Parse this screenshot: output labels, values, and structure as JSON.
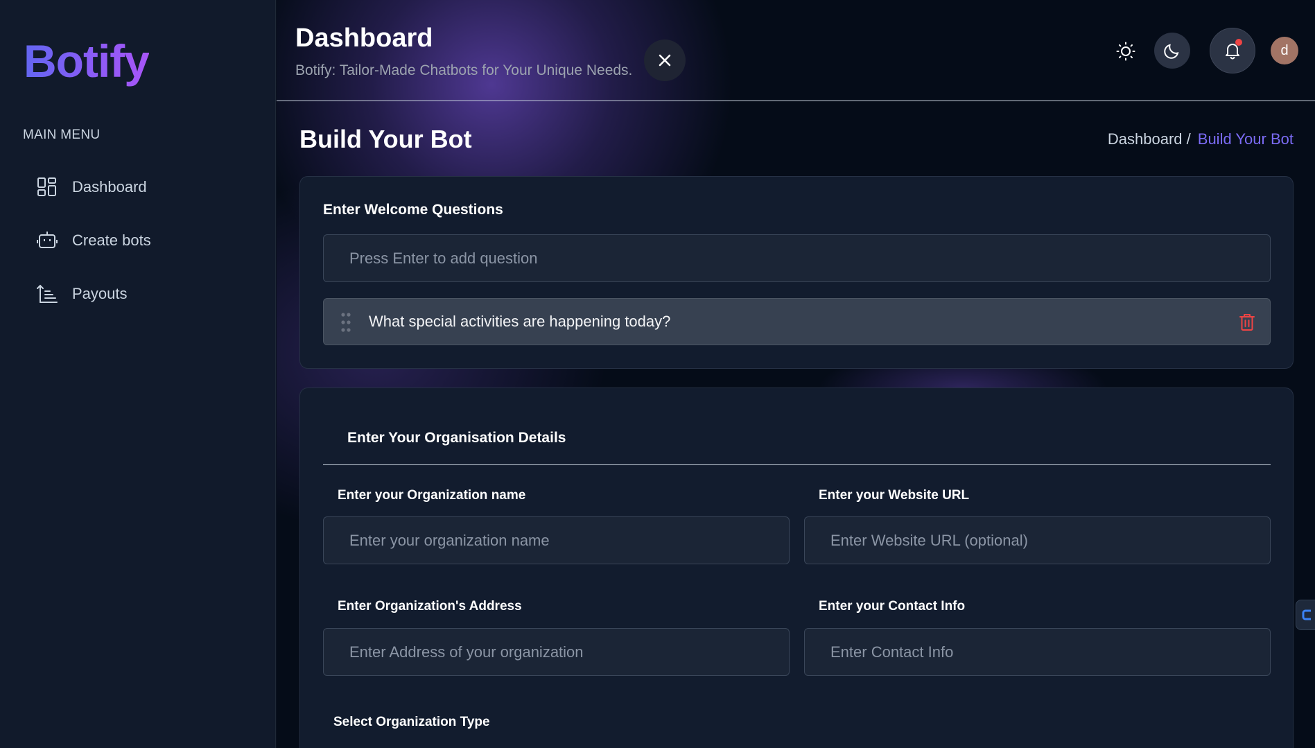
{
  "sidebar": {
    "logo": "Botify",
    "menu_heading": "MAIN MENU",
    "items": [
      {
        "label": "Dashboard",
        "icon": "dashboard-grid-icon"
      },
      {
        "label": "Create bots",
        "icon": "robot-icon"
      },
      {
        "label": "Payouts",
        "icon": "sort-list-icon"
      }
    ]
  },
  "header": {
    "title": "Dashboard",
    "subtitle": "Botify: Tailor-Made Chatbots for Your Unique Needs.",
    "avatar_initial": "d"
  },
  "page": {
    "title": "Build Your Bot",
    "breadcrumb": {
      "home": "Dashboard /",
      "current": "Build Your Bot"
    }
  },
  "welcome": {
    "heading": "Enter Welcome Questions",
    "input_placeholder": "Press Enter to add question",
    "questions": [
      "What special activities are happening today?"
    ]
  },
  "organisation": {
    "heading": "Enter Your Organisation Details",
    "fields": {
      "name": {
        "label": "Enter your Organization name",
        "placeholder": "Enter your organization name"
      },
      "website": {
        "label": "Enter your Website URL",
        "placeholder": "Enter Website URL (optional)"
      },
      "address": {
        "label": "Enter Organization's Address",
        "placeholder": "Enter Address of your organization"
      },
      "contact": {
        "label": "Enter your Contact Info",
        "placeholder": "Enter Contact Info"
      }
    },
    "type_label": "Select Organization Type"
  },
  "colors": {
    "accent": "#7c6cf6",
    "logo_gradient_start": "#6366f1",
    "logo_gradient_end": "#a855f7",
    "notification_dot": "#ef4444",
    "delete": "#ef4444"
  }
}
